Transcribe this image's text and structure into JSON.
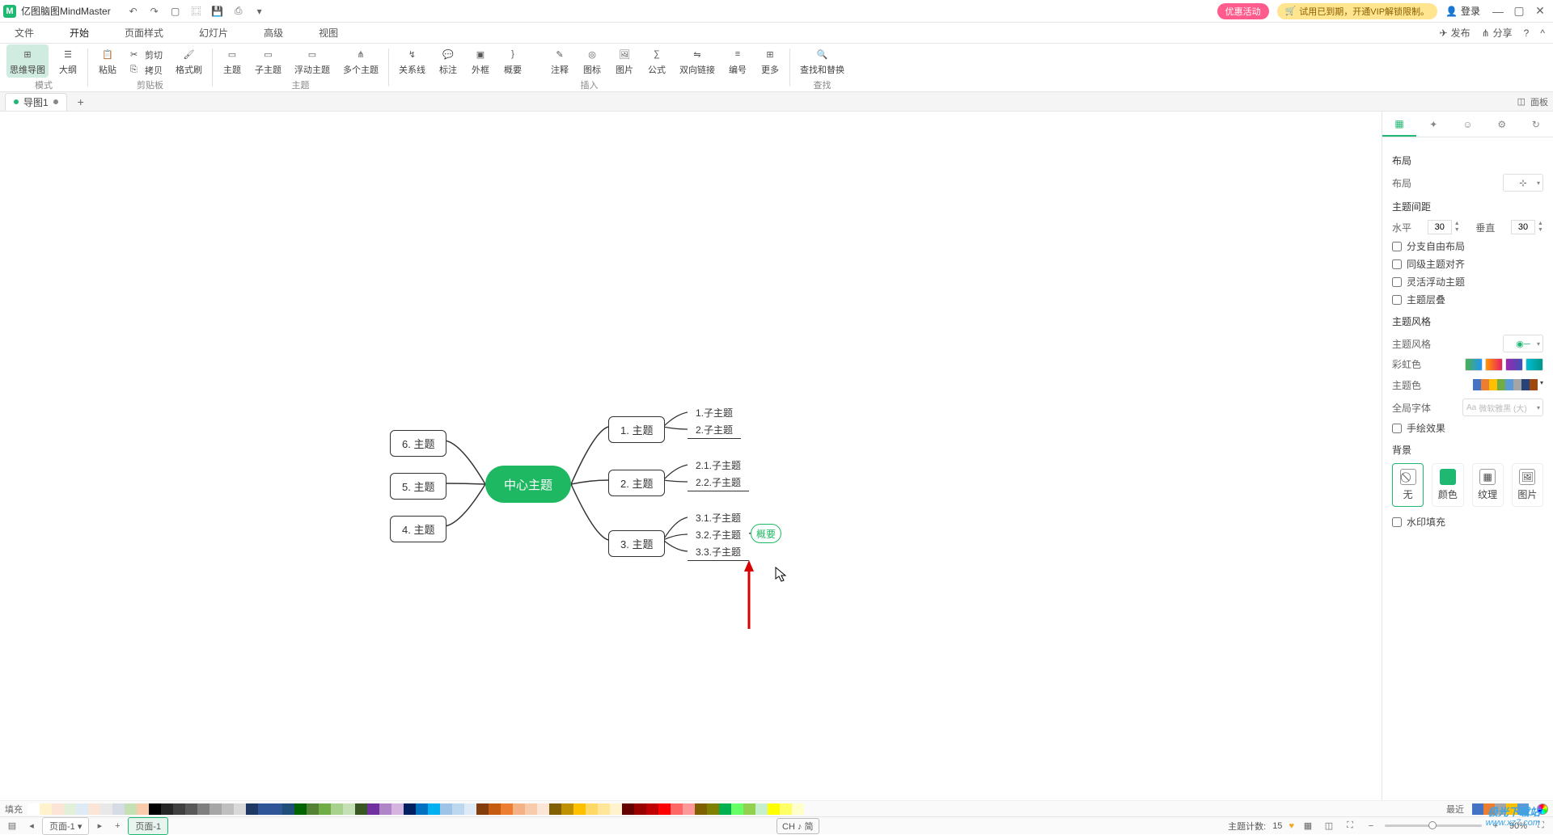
{
  "titlebar": {
    "app_name": "亿图脑图MindMaster",
    "qat": [
      "undo",
      "redo",
      "new",
      "open",
      "save",
      "print",
      "options"
    ],
    "promo": "优惠活动",
    "trial": "试用已到期，开通VIP解锁限制。",
    "login": "登录"
  },
  "menubar": {
    "items": [
      "文件",
      "开始",
      "页面样式",
      "幻灯片",
      "高级",
      "视图"
    ],
    "active": 1,
    "right": {
      "publish": "发布",
      "share": "分享"
    }
  },
  "ribbon": {
    "groups": [
      {
        "label": "模式",
        "items": [
          {
            "name": "mindmap",
            "label": "思维导图",
            "active": true
          },
          {
            "name": "outline",
            "label": "大纲"
          }
        ]
      },
      {
        "label": "剪贴板",
        "items": [
          {
            "name": "paste",
            "label": "粘贴"
          }
        ],
        "smalls": [
          {
            "name": "cut",
            "label": "剪切"
          },
          {
            "name": "copy",
            "label": "拷贝"
          }
        ],
        "extra": [
          {
            "name": "formatpainter",
            "label": "格式刷"
          }
        ]
      },
      {
        "label": "主题",
        "items": [
          {
            "name": "topic",
            "label": "主题"
          },
          {
            "name": "subtopic",
            "label": "子主题"
          },
          {
            "name": "floating",
            "label": "浮动主题"
          },
          {
            "name": "multi",
            "label": "多个主题"
          }
        ]
      },
      {
        "label": "插入",
        "sub1": [
          {
            "name": "relation",
            "label": "关系线"
          },
          {
            "name": "callout",
            "label": "标注"
          },
          {
            "name": "boundary",
            "label": "外框"
          },
          {
            "name": "summary",
            "label": "概要"
          }
        ],
        "sub2": [
          {
            "name": "note",
            "label": "注释"
          },
          {
            "name": "tag",
            "label": "图标"
          },
          {
            "name": "image",
            "label": "图片"
          },
          {
            "name": "formula",
            "label": "公式"
          },
          {
            "name": "bilink",
            "label": "双向链接"
          },
          {
            "name": "numbering",
            "label": "编号"
          },
          {
            "name": "more",
            "label": "更多"
          }
        ]
      },
      {
        "label": "查找",
        "items": [
          {
            "name": "findreplace",
            "label": "查找和替换"
          }
        ]
      }
    ]
  },
  "tabs": {
    "doc": "导图1",
    "panel_toggle": "面板"
  },
  "mindmap": {
    "center": "中心主题",
    "left": [
      {
        "id": "t6",
        "label": "6. 主题"
      },
      {
        "id": "t5",
        "label": "5. 主题"
      },
      {
        "id": "t4",
        "label": "4. 主题"
      }
    ],
    "right": [
      {
        "id": "t1",
        "label": "1. 主题",
        "subs": [
          "1.子主题",
          "2.子主题"
        ]
      },
      {
        "id": "t2",
        "label": "2. 主题",
        "subs": [
          "2.1.子主题",
          "2.2.子主题"
        ]
      },
      {
        "id": "t3",
        "label": "3. 主题",
        "subs": [
          "3.1.子主题",
          "3.2.子主题",
          "3.3.子主题"
        ]
      }
    ],
    "summary": "概要"
  },
  "rpanel": {
    "section_layout": "布局",
    "layout_label": "布局",
    "spacing_title": "主题间距",
    "horiz": "水平",
    "horiz_val": "30",
    "vert": "垂直",
    "vert_val": "30",
    "chk_free": "分支自由布局",
    "chk_align": "同级主题对齐",
    "chk_float": "灵活浮动主题",
    "chk_fold": "主题层叠",
    "section_style": "主题风格",
    "style_label": "主题风格",
    "rainbow": "彩虹色",
    "theme_color": "主题色",
    "font": "全局字体",
    "font_placeholder": "微软雅黑 (大)",
    "chk_hand": "手绘效果",
    "section_bg": "背景",
    "bg_none": "无",
    "bg_color": "颜色",
    "bg_texture": "纹理",
    "bg_image": "图片",
    "chk_watermark": "水印填充"
  },
  "colorbar": {
    "fill": "填充",
    "recent": "最近",
    "fill_colors": [
      "#ffffff",
      "#fff2cc",
      "#fce4d6",
      "#e2f0d9",
      "#deebf7",
      "#fbe5d6",
      "#e8e8e8",
      "#d6dce5",
      "#c5e0b4",
      "#f8cbad",
      "#000000",
      "#262626",
      "#404040",
      "#595959",
      "#7f7f7f",
      "#a6a6a6",
      "#bfbfbf",
      "#d9d9d9",
      "#203864",
      "#2e5597",
      "#2f5597",
      "#1f4e79",
      "#006400",
      "#548235",
      "#70ad47",
      "#a9d18e",
      "#c5e0b4",
      "#385723",
      "#7030a0",
      "#b085c8",
      "#d6b4e0",
      "#002060",
      "#0070c0",
      "#00b0f0",
      "#9dc3e6",
      "#bdd7ee",
      "#deebf7",
      "#833c0c",
      "#c55a11",
      "#ed7d31",
      "#f4b183",
      "#f8cbad",
      "#fbe5d6",
      "#806000",
      "#bf9000",
      "#ffc000",
      "#ffd966",
      "#ffe699",
      "#fff2cc",
      "#660000",
      "#990000",
      "#c00000",
      "#ff0000",
      "#ff6666",
      "#ff9999",
      "#7f6000",
      "#808000",
      "#00b050",
      "#66ff66",
      "#92d050",
      "#c6efce",
      "#ffff00",
      "#ffff66",
      "#ffffcc"
    ],
    "recent_colors": [
      "#4472c4",
      "#ed7d31",
      "#a5a5a5",
      "#ffc000",
      "#5b9bd5"
    ]
  },
  "statusbar": {
    "page_dd": "页面-1",
    "page_tab": "页面-1",
    "topic_count_label": "主题计数:",
    "topic_count": "15",
    "ime": "CH ♪ 简",
    "zoom": "90%"
  },
  "watermark": {
    "line1": "极光下载站",
    "line2": "www.xz7.com"
  }
}
